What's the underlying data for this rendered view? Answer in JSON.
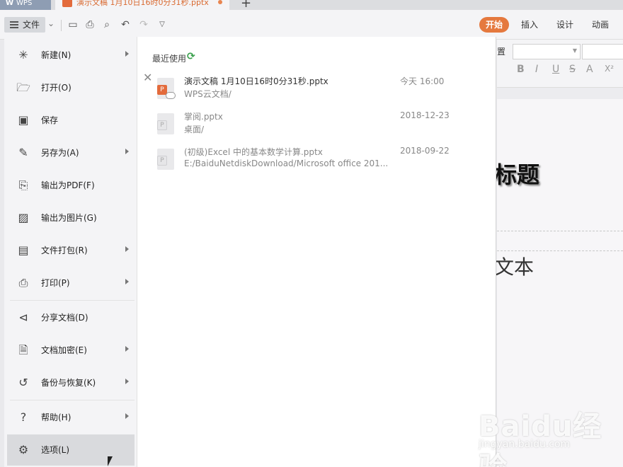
{
  "tabs": {
    "wps_label": "WPS",
    "doc_label": "演示文稿 1月10日16时0分31秒.pptx",
    "add_label": "+"
  },
  "toolbar": {
    "file_label": "文件",
    "ribbon_tabs": [
      "开始",
      "插入",
      "设计",
      "动画"
    ],
    "active_tab": "开始",
    "accent_color": "#e5793e"
  },
  "ribbon_right": {
    "partial_label": "置",
    "format_buttons": [
      "B",
      "I",
      "U",
      "S",
      "A",
      "X²"
    ]
  },
  "file_menu": {
    "items": [
      {
        "label": "新建(N)",
        "icon": "new-icon",
        "has_submenu": true
      },
      {
        "label": "打开(O)",
        "icon": "folder-open-icon",
        "has_submenu": false
      },
      {
        "label": "保存",
        "icon": "save-icon",
        "has_submenu": false
      },
      {
        "label": "另存为(A)",
        "icon": "save-as-icon",
        "has_submenu": true
      },
      {
        "label": "输出为PDF(F)",
        "icon": "export-pdf-icon",
        "has_submenu": false
      },
      {
        "label": "输出为图片(G)",
        "icon": "export-image-icon",
        "has_submenu": false
      },
      {
        "label": "文件打包(R)",
        "icon": "package-icon",
        "has_submenu": true
      },
      {
        "label": "打印(P)",
        "icon": "print-icon",
        "has_submenu": true
      },
      {
        "label": "分享文档(D)",
        "icon": "share-icon",
        "has_submenu": false
      },
      {
        "label": "文档加密(E)",
        "icon": "encrypt-icon",
        "has_submenu": true
      },
      {
        "label": "备份与恢复(K)",
        "icon": "backup-icon",
        "has_submenu": true
      },
      {
        "label": "帮助(H)",
        "icon": "help-icon",
        "has_submenu": true
      },
      {
        "label": "选项(L)",
        "icon": "gear-icon",
        "has_submenu": false,
        "selected": true
      }
    ]
  },
  "recent": {
    "title": "最近使用",
    "files": [
      {
        "name": "演示文稿 1月10日16时0分31秒.pptx",
        "path": "WPS云文档/",
        "date": "今天 16:00"
      },
      {
        "name": "掌阅.pptx",
        "path": "桌面/",
        "date": "2018-12-23"
      },
      {
        "name": "(初级)Excel 中的基本数学计算.pptx",
        "path": "E:/BaiduNetdiskDownload/Microsoft office 201...",
        "date": "2018-09-22"
      }
    ]
  },
  "slide": {
    "title_fragment": "标题",
    "subtitle_fragment": "文本"
  },
  "watermark": {
    "text": "Baidu经验",
    "url": "jingyan.baidu.com"
  }
}
